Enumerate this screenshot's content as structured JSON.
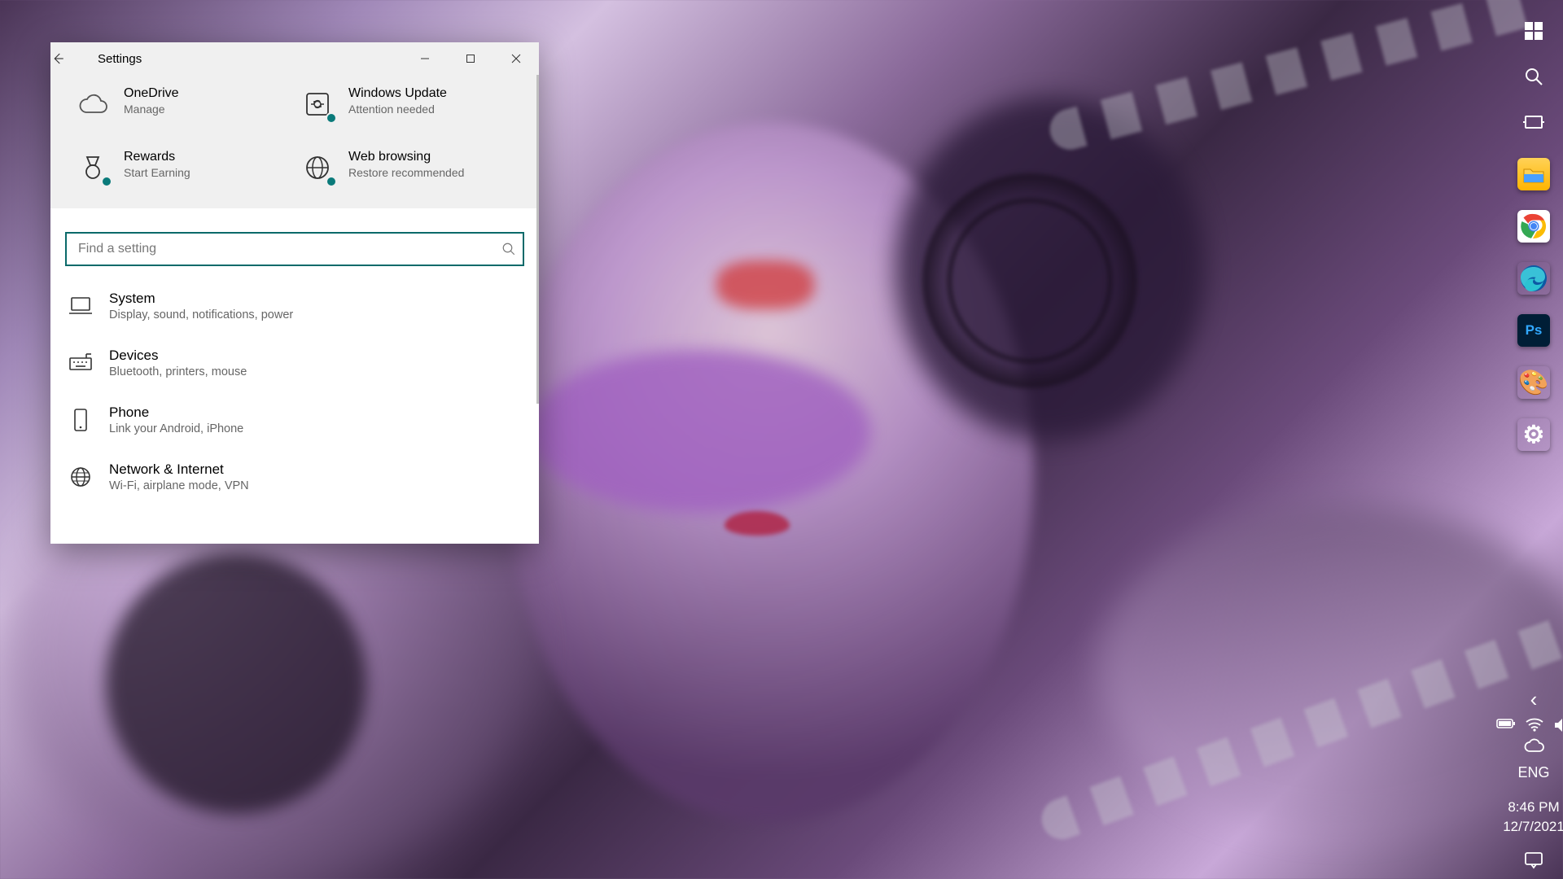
{
  "window": {
    "title": "Settings"
  },
  "top_cards": [
    {
      "title": "OneDrive",
      "subtitle": "Manage",
      "icon": "cloud",
      "badge": false
    },
    {
      "title": "Windows Update",
      "subtitle": "Attention needed",
      "icon": "refresh",
      "badge": true
    },
    {
      "title": "Rewards",
      "subtitle": "Start Earning",
      "icon": "medal",
      "badge": true
    },
    {
      "title": "Web browsing",
      "subtitle": "Restore recommended",
      "icon": "globe",
      "badge": true
    }
  ],
  "search": {
    "placeholder": "Find a setting"
  },
  "categories": [
    {
      "title": "System",
      "subtitle": "Display, sound, notifications, power",
      "icon": "laptop"
    },
    {
      "title": "Devices",
      "subtitle": "Bluetooth, printers, mouse",
      "icon": "keyboard"
    },
    {
      "title": "Phone",
      "subtitle": "Link your Android, iPhone",
      "icon": "phone"
    },
    {
      "title": "Network & Internet",
      "subtitle": "Wi-Fi, airplane mode, VPN",
      "icon": "globe"
    }
  ],
  "taskbar": {
    "apps": [
      {
        "name": "start",
        "label": "⊞"
      },
      {
        "name": "search",
        "label": "search"
      },
      {
        "name": "task-view",
        "label": "taskview"
      },
      {
        "name": "file-explorer",
        "bg": "#ffcc33",
        "fg": "#2266cc",
        "label": "▀▀"
      },
      {
        "name": "chrome",
        "bg": "radial",
        "label": ""
      },
      {
        "name": "edge",
        "bg": "#0b57d0",
        "label": ""
      },
      {
        "name": "photoshop",
        "bg": "#001e36",
        "fg": "#31a8ff",
        "label": "Ps"
      },
      {
        "name": "paint",
        "bg": "transparent",
        "label": "🎨"
      },
      {
        "name": "settings",
        "bg": "transparent",
        "label": "⚙"
      }
    ],
    "tray": {
      "chevron": "‹",
      "battery": true,
      "wifi": true,
      "volume": true,
      "onedrive": true,
      "language": "ENG",
      "time": "8:46 PM",
      "date": "12/7/2021"
    }
  }
}
